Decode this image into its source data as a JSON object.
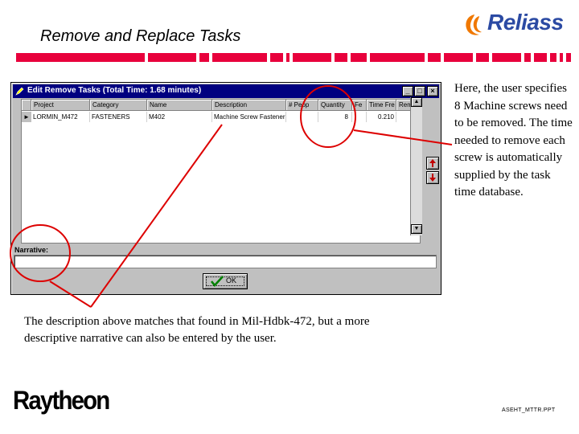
{
  "slide": {
    "title": "Remove and Replace Tasks",
    "brand_logo_text": "Reliass",
    "footer_logo_text": "Raytheon",
    "footer_code": "ASEHT_MTTR.PPT",
    "side_note": "Here, the user specifies 8 Machine screws need to be removed. The time needed to remove each screw is automatically supplied by the task time database.",
    "bottom_note": "The description above matches that found in Mil-Hdbk-472, but a more descriptive narrative can also be entered by the user."
  },
  "window": {
    "title": "Edit Remove Tasks (Total Time: 1.68 minutes)",
    "buttons": {
      "minimize": "_",
      "maximize": "□",
      "close": "×"
    },
    "table": {
      "columns": [
        "Project",
        "Category",
        "Name",
        "Description",
        "# Peop",
        "Quantity",
        "Fe",
        "Time Fre",
        "Rem"
      ],
      "rows": [
        [
          "LORMIN_M472",
          "FASTENERS",
          "M402",
          "Machine Screw Fastener",
          "",
          "8",
          "",
          "0.210",
          ""
        ]
      ]
    },
    "narrative_label": "Narrative:",
    "ok_label": "OK"
  },
  "colors": {
    "accent_band": "#e8003c",
    "annotation": "#dd0000",
    "titlebar": "#000080",
    "logo_blue": "#2b4aa3",
    "logo_orange": "#f07800"
  }
}
